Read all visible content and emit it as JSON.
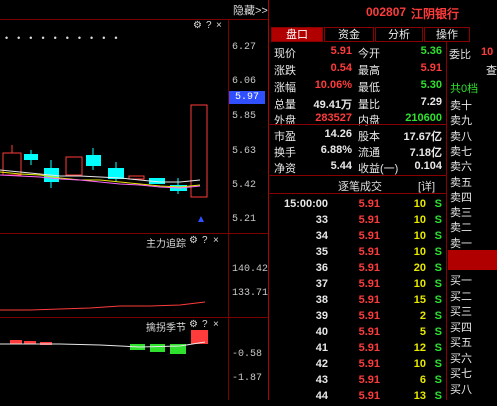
{
  "header": {
    "collapse_label": "隐藏>>",
    "stock_code": "002807",
    "stock_name": "江阴银行"
  },
  "icons": {
    "gear": "gear-icon",
    "help": "question-icon",
    "close": "close-icon"
  },
  "price_axis": {
    "labels": [
      "6.27",
      "6.06",
      "5.85",
      "5.63",
      "5.42",
      "5.21"
    ],
    "current": "5.97"
  },
  "panels": {
    "main_force": {
      "title": "主力追踪",
      "labels": [
        "140.42",
        "133.71"
      ]
    },
    "season": {
      "title": "擒拐季节",
      "labels": [
        "-0.58",
        "-1.87"
      ]
    }
  },
  "controls": {
    "gear": "⚙",
    "help": "?",
    "close": "×"
  },
  "tabs": [
    "盘口",
    "资金",
    "分析",
    "操作"
  ],
  "quote": {
    "rows": [
      {
        "l1": "现价",
        "v1": "5.91",
        "c1": "red",
        "l2": "今开",
        "v2": "5.36",
        "c2": "green"
      },
      {
        "l1": "涨跌",
        "v1": "0.54",
        "c1": "red",
        "l2": "最高",
        "v2": "5.91",
        "c2": "red"
      },
      {
        "l1": "涨幅",
        "v1": "10.06%",
        "c1": "red",
        "l2": "最低",
        "v2": "5.30",
        "c2": "green"
      },
      {
        "l1": "总量",
        "v1": "49.41万",
        "c1": "white",
        "l2": "量比",
        "v2": "7.29",
        "c2": "white"
      },
      {
        "l1": "外盘",
        "v1": "283527",
        "c1": "red",
        "l2": "内盘",
        "v2": "210600",
        "c2": "green"
      },
      {
        "l1": "市盈",
        "v1": "14.26",
        "c1": "white",
        "l2": "股本",
        "v2": "17.67亿",
        "c2": "white"
      },
      {
        "l1": "换手",
        "v1": "6.88%",
        "c1": "white",
        "l2": "流通",
        "v2": "7.18亿",
        "c2": "white"
      },
      {
        "l1": "净资",
        "v1": "5.44",
        "c1": "white",
        "l2": "收益(一)",
        "v2": "0.104",
        "c2": "white"
      }
    ]
  },
  "ticks": {
    "title": "逐笔成交",
    "detail_label": "[详]",
    "rows": [
      {
        "time": "15:00:00",
        "price": "5.91",
        "vol": "10",
        "side": "S"
      },
      {
        "time": "33",
        "price": "5.91",
        "vol": "10",
        "side": "S"
      },
      {
        "time": "34",
        "price": "5.91",
        "vol": "10",
        "side": "S"
      },
      {
        "time": "35",
        "price": "5.91",
        "vol": "10",
        "side": "S"
      },
      {
        "time": "36",
        "price": "5.91",
        "vol": "20",
        "side": "S"
      },
      {
        "time": "37",
        "price": "5.91",
        "vol": "10",
        "side": "S"
      },
      {
        "time": "38",
        "price": "5.91",
        "vol": "15",
        "side": "S"
      },
      {
        "time": "39",
        "price": "5.91",
        "vol": "2",
        "side": "S"
      },
      {
        "time": "40",
        "price": "5.91",
        "vol": "5",
        "side": "S"
      },
      {
        "time": "41",
        "price": "5.91",
        "vol": "12",
        "side": "S"
      },
      {
        "time": "42",
        "price": "5.91",
        "vol": "10",
        "side": "S"
      },
      {
        "time": "43",
        "price": "5.91",
        "vol": "6",
        "side": "S"
      },
      {
        "time": "44",
        "price": "5.91",
        "vol": "13",
        "side": "S"
      }
    ]
  },
  "order_book": {
    "wei_bi_label": "委比",
    "wei_bi_value": "10",
    "check_label": "查",
    "total_label": "共0档",
    "sell": [
      "卖十",
      "卖九",
      "卖八",
      "卖七",
      "卖六",
      "卖五",
      "卖四",
      "卖三",
      "卖二",
      "卖一"
    ],
    "buy": [
      "买一",
      "买二",
      "买三",
      "买四",
      "买五",
      "买六",
      "买七",
      "买八"
    ]
  },
  "colors": {
    "up": "#ff3b3b",
    "down": "#2fe02f",
    "grid": "#7a0000",
    "highlight": "#3050ff"
  }
}
